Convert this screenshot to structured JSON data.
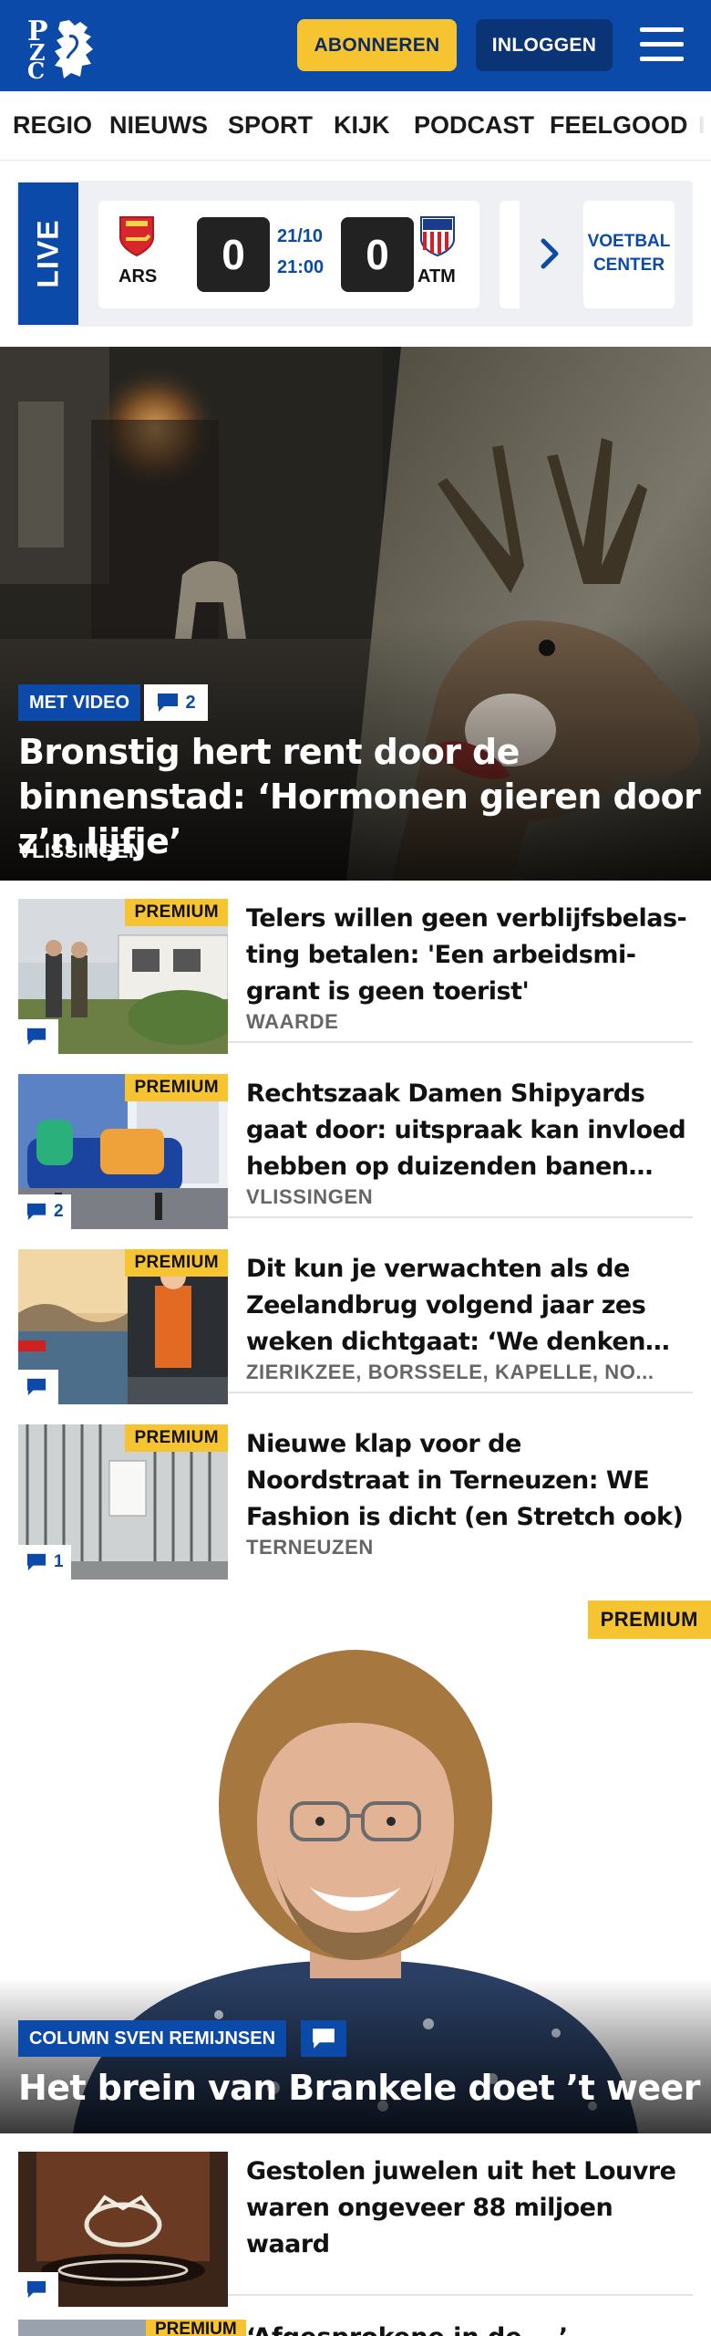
{
  "header": {
    "logo_text": "PZC",
    "subscribe_label": "ABONNEREN",
    "login_label": "INLOGGEN",
    "menu_icon": "hamburger-menu-icon",
    "brand_color": "#0b4aa8",
    "accent_color": "#f7c431"
  },
  "nav": {
    "items": [
      "REGIO",
      "NIEUWS",
      "SPORT",
      "KIJK",
      "PODCAST",
      "FEELGOOD"
    ]
  },
  "live": {
    "label": "LIVE",
    "match": {
      "home_abbr": "ARS",
      "home_score": "0",
      "date": "21/10",
      "time": "21:00",
      "away_score": "0",
      "away_abbr": "ATM"
    },
    "center_line1": "VOETBAL",
    "center_line2": "CENTER"
  },
  "hero": {
    "badge": "MET VIDEO",
    "comments": "2",
    "title": "Bronstig hert rent door de binnenstad: ‘Hormonen gieren door z’n lijfje’",
    "place": "VLISSINGEN"
  },
  "articles": [
    {
      "premium": "PREMIUM",
      "title": "Telers willen geen verblijfsbelas­ting betalen: 'Een arbeidsmi­grant is geen toerist'",
      "place": "WAARDE",
      "comments": ""
    },
    {
      "premium": "PREMIUM",
      "title": "Rechtszaak Damen Shipyards gaat door: uitspraak kan invloed hebben op duizenden banen en...",
      "place": "VLISSINGEN",
      "comments": "2"
    },
    {
      "premium": "PREMIUM",
      "title": "Dit kun je verwachten als de Zeelandbrug volgend jaar zes weken dichtgaat: ‘We denken a...",
      "place": "ZIERIKZEE, BORSSELE, KAPELLE, NO...",
      "comments": ""
    },
    {
      "premium": "PREMIUM",
      "title": "Nieuwe klap voor de Noordstraat in Terneuzen: WE Fashion is dicht (en Stretch ook)",
      "place": "TERNEUZEN",
      "comments": "1"
    }
  ],
  "column": {
    "premium": "PREMIUM",
    "badge": "COLUMN SVEN REMIJNSEN",
    "title": "Het brein van Brankele doet ’t weer"
  },
  "article_bottom": {
    "title": "Gestolen juwelen uit het Louvre waren ongeveer 88 miljoen waard",
    "comments": ""
  },
  "next_peek": {
    "premium": "PREMIUM",
    "title": "‘Afgesprokene in de ...’"
  }
}
